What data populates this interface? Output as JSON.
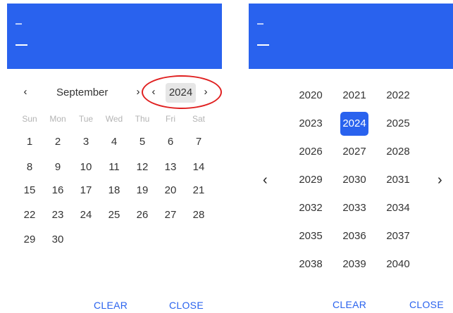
{
  "left": {
    "header": {
      "color": "#2962ee"
    },
    "nav": {
      "prev_month": "‹",
      "month": "September",
      "next_month": "›",
      "prev_year": "‹",
      "year": "2024",
      "next_year": "›"
    },
    "weekdays": [
      "Sun",
      "Mon",
      "Tue",
      "Wed",
      "Thu",
      "Fri",
      "Sat"
    ],
    "weeks": [
      [
        "1",
        "2",
        "3",
        "4",
        "5",
        "6",
        "7"
      ],
      [
        "8",
        "9",
        "10",
        "11",
        "12",
        "13",
        "14"
      ],
      [
        "15",
        "16",
        "17",
        "18",
        "19",
        "20",
        "21"
      ],
      [
        "22",
        "23",
        "24",
        "25",
        "26",
        "27",
        "28"
      ],
      [
        "29",
        "30",
        "",
        "",
        "",
        "",
        ""
      ]
    ],
    "footer": {
      "clear": "CLEAR",
      "close": "CLOSE"
    }
  },
  "right": {
    "header": {
      "color": "#2962ee"
    },
    "prev": "‹",
    "next": "›",
    "years": [
      [
        "2020",
        "2021",
        "2022"
      ],
      [
        "2023",
        "2024",
        "2025"
      ],
      [
        "2026",
        "2027",
        "2028"
      ],
      [
        "2029",
        "2030",
        "2031"
      ],
      [
        "2032",
        "2033",
        "2034"
      ],
      [
        "2035",
        "2036",
        "2037"
      ],
      [
        "2038",
        "2039",
        "2040"
      ]
    ],
    "selected_year": "2024",
    "footer": {
      "clear": "CLEAR",
      "close": "CLOSE"
    }
  },
  "colors": {
    "accent": "#2962ee",
    "highlight_ring": "#e02020",
    "year_chip_bg": "#e6e6e6"
  }
}
